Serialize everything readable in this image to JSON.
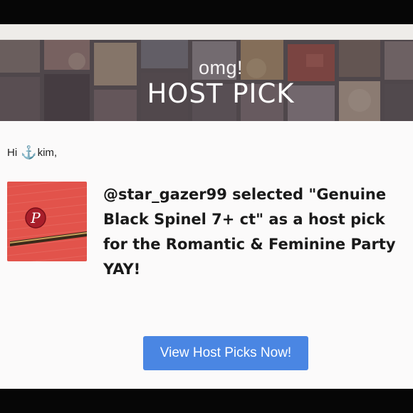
{
  "banner": {
    "eyebrow": "omg!",
    "title": "HOST PICK"
  },
  "greeting": {
    "prefix": "Hi",
    "icon": "anchor-icon",
    "username": "kim,"
  },
  "message": {
    "lines": [
      "@star_gazer99 selected \"Genuine",
      "Black Spinel 7+ ct\" as a host pick",
      "for the Romantic & Feminine Party",
      "YAY!"
    ]
  },
  "thumbnail": {
    "badge_icon": "poshmark-logo-icon",
    "colors": {
      "background": "#e8574f",
      "badge": "#a81e2a"
    }
  },
  "cta": {
    "label": "View Host Picks Now!",
    "color": "#4a86e3"
  }
}
